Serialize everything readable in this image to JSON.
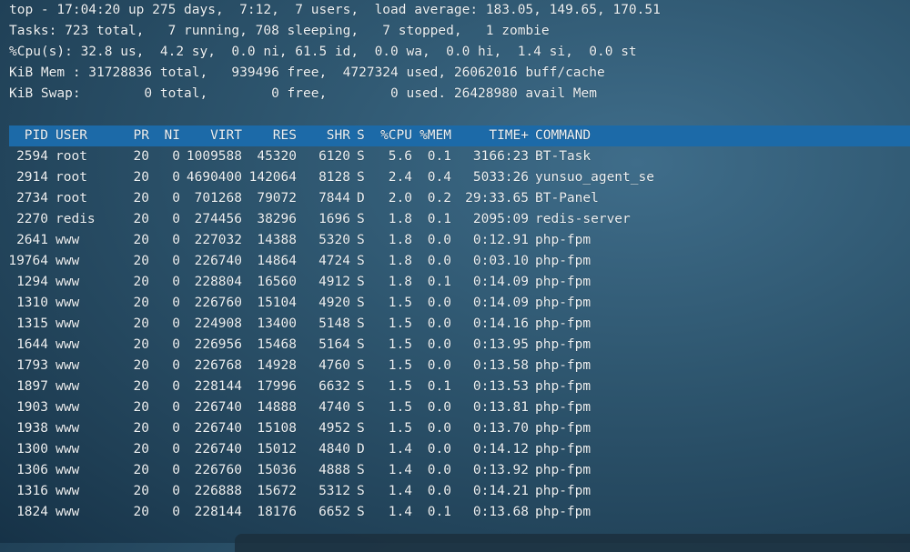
{
  "summary": {
    "line1": "top - 17:04:20 up 275 days,  7:12,  7 users,  load average: 183.05, 149.65, 170.51",
    "line2": "Tasks: 723 total,   7 running, 708 sleeping,   7 stopped,   1 zombie",
    "line3": "%Cpu(s): 32.8 us,  4.2 sy,  0.0 ni, 61.5 id,  0.0 wa,  0.0 hi,  1.4 si,  0.0 st",
    "line4": "KiB Mem : 31728836 total,   939496 free,  4727324 used, 26062016 buff/cache",
    "line5": "KiB Swap:        0 total,        0 free,        0 used. 26428980 avail Mem"
  },
  "columns": [
    "PID",
    "USER",
    "PR",
    "NI",
    "VIRT",
    "RES",
    "SHR",
    "S",
    "%CPU",
    "%MEM",
    "TIME+",
    "COMMAND"
  ],
  "processes": [
    [
      "2594",
      "root",
      "20",
      "0",
      "1009588",
      "45320",
      "6120",
      "S",
      "5.6",
      "0.1",
      "3166:23",
      "BT-Task"
    ],
    [
      "2914",
      "root",
      "20",
      "0",
      "4690400",
      "142064",
      "8128",
      "S",
      "2.4",
      "0.4",
      "5033:26",
      "yunsuo_agent_se"
    ],
    [
      "2734",
      "root",
      "20",
      "0",
      "701268",
      "79072",
      "7844",
      "D",
      "2.0",
      "0.2",
      "29:33.65",
      "BT-Panel"
    ],
    [
      "2270",
      "redis",
      "20",
      "0",
      "274456",
      "38296",
      "1696",
      "S",
      "1.8",
      "0.1",
      "2095:09",
      "redis-server"
    ],
    [
      "2641",
      "www",
      "20",
      "0",
      "227032",
      "14388",
      "5320",
      "S",
      "1.8",
      "0.0",
      "0:12.91",
      "php-fpm"
    ],
    [
      "19764",
      "www",
      "20",
      "0",
      "226740",
      "14864",
      "4724",
      "S",
      "1.8",
      "0.0",
      "0:03.10",
      "php-fpm"
    ],
    [
      "1294",
      "www",
      "20",
      "0",
      "228804",
      "16560",
      "4912",
      "S",
      "1.8",
      "0.1",
      "0:14.09",
      "php-fpm"
    ],
    [
      "1310",
      "www",
      "20",
      "0",
      "226760",
      "15104",
      "4920",
      "S",
      "1.5",
      "0.0",
      "0:14.09",
      "php-fpm"
    ],
    [
      "1315",
      "www",
      "20",
      "0",
      "224908",
      "13400",
      "5148",
      "S",
      "1.5",
      "0.0",
      "0:14.16",
      "php-fpm"
    ],
    [
      "1644",
      "www",
      "20",
      "0",
      "226956",
      "15468",
      "5164",
      "S",
      "1.5",
      "0.0",
      "0:13.95",
      "php-fpm"
    ],
    [
      "1793",
      "www",
      "20",
      "0",
      "226768",
      "14928",
      "4760",
      "S",
      "1.5",
      "0.0",
      "0:13.58",
      "php-fpm"
    ],
    [
      "1897",
      "www",
      "20",
      "0",
      "228144",
      "17996",
      "6632",
      "S",
      "1.5",
      "0.1",
      "0:13.53",
      "php-fpm"
    ],
    [
      "1903",
      "www",
      "20",
      "0",
      "226740",
      "14888",
      "4740",
      "S",
      "1.5",
      "0.0",
      "0:13.81",
      "php-fpm"
    ],
    [
      "1938",
      "www",
      "20",
      "0",
      "226740",
      "15108",
      "4952",
      "S",
      "1.5",
      "0.0",
      "0:13.70",
      "php-fpm"
    ],
    [
      "1300",
      "www",
      "20",
      "0",
      "226740",
      "15012",
      "4840",
      "D",
      "1.4",
      "0.0",
      "0:14.12",
      "php-fpm"
    ],
    [
      "1306",
      "www",
      "20",
      "0",
      "226760",
      "15036",
      "4888",
      "S",
      "1.4",
      "0.0",
      "0:13.92",
      "php-fpm"
    ],
    [
      "1316",
      "www",
      "20",
      "0",
      "226888",
      "15672",
      "5312",
      "S",
      "1.4",
      "0.0",
      "0:14.21",
      "php-fpm"
    ],
    [
      "1824",
      "www",
      "20",
      "0",
      "228144",
      "18176",
      "6652",
      "S",
      "1.4",
      "0.1",
      "0:13.68",
      "php-fpm"
    ]
  ],
  "colors": {
    "header_bar": "#1c6aa8",
    "text": "#eef3f6"
  }
}
